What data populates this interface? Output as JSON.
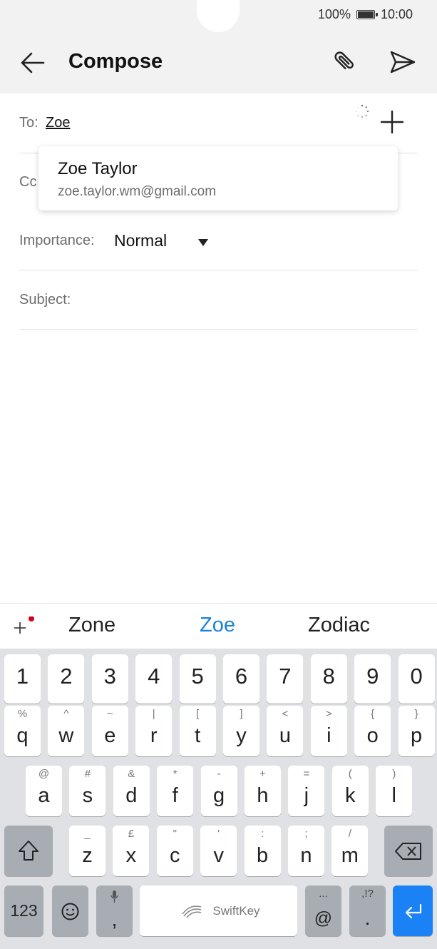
{
  "status": {
    "battery": "100%",
    "time": "10:00"
  },
  "header": {
    "title": "Compose"
  },
  "to": {
    "label": "To:",
    "recipient": "Zoe"
  },
  "cc": {
    "label": "Cc"
  },
  "importance": {
    "label": "Importance:",
    "value": "Normal"
  },
  "subject": {
    "label": "Subject:"
  },
  "suggestion": {
    "name": "Zoe Taylor",
    "email": "zoe.taylor.wm@gmail.com"
  },
  "predictions": [
    "Zone",
    "Zoe",
    "Zodiac"
  ],
  "keyboard": {
    "numbers": [
      "1",
      "2",
      "3",
      "4",
      "5",
      "6",
      "7",
      "8",
      "9",
      "0"
    ],
    "row1": [
      [
        "q",
        "%"
      ],
      [
        "w",
        "^"
      ],
      [
        "e",
        "~"
      ],
      [
        "r",
        "|"
      ],
      [
        "t",
        "["
      ],
      [
        "y",
        "]"
      ],
      [
        "u",
        "<"
      ],
      [
        "i",
        ">"
      ],
      [
        "o",
        "{"
      ],
      [
        "p",
        "}"
      ]
    ],
    "row2": [
      [
        "a",
        "@"
      ],
      [
        "s",
        "#"
      ],
      [
        "d",
        "&"
      ],
      [
        "f",
        "*"
      ],
      [
        "g",
        "-"
      ],
      [
        "h",
        "+"
      ],
      [
        "j",
        "="
      ],
      [
        "k",
        "("
      ],
      [
        "l",
        ")"
      ]
    ],
    "row3": [
      [
        "z",
        "_"
      ],
      [
        "x",
        "£"
      ],
      [
        "c",
        "\""
      ],
      [
        "v",
        "'"
      ],
      [
        "b",
        ":"
      ],
      [
        "n",
        ";"
      ],
      [
        "m",
        "/"
      ]
    ],
    "symbols_label": "123",
    "space_label": "SwiftKey",
    "comma": ",",
    "at": "@",
    "at_hint": "...",
    "period": ".",
    "period_hint": ",!?"
  },
  "colors": {
    "accent": "#1a82f5",
    "prediction_active": "#1a82d9",
    "notification_dot": "#d0021b"
  },
  "icons": [
    "back-arrow-icon",
    "paperclip-icon",
    "send-icon",
    "loading-spinner-icon",
    "plus-icon",
    "dropdown-caret-icon",
    "shift-icon",
    "backspace-icon",
    "emoji-icon",
    "microphone-icon",
    "swiftkey-logo-icon",
    "enter-icon"
  ]
}
